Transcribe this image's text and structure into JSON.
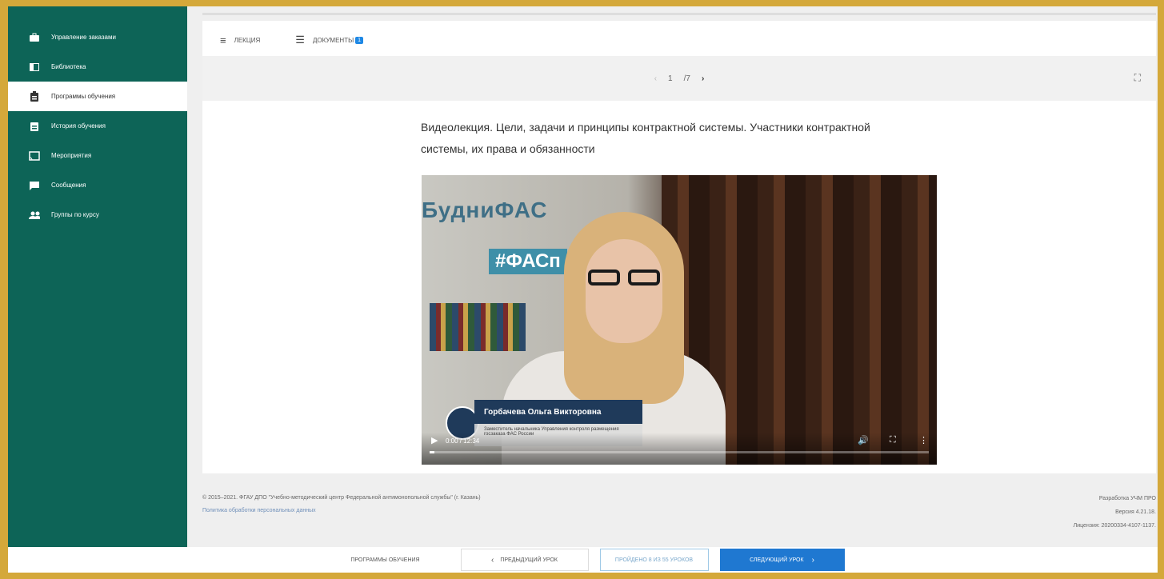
{
  "sidebar": {
    "items": [
      {
        "label": "Управление заказами",
        "icon": "briefcase-icon",
        "active": false
      },
      {
        "label": "Библиотека",
        "icon": "library-icon",
        "active": false
      },
      {
        "label": "Программы обучения",
        "icon": "clipboard-icon",
        "active": true
      },
      {
        "label": "История обучения",
        "icon": "history-icon",
        "active": false
      },
      {
        "label": "Мероприятия",
        "icon": "cast-icon",
        "active": false
      },
      {
        "label": "Сообщения",
        "icon": "message-icon",
        "active": false
      },
      {
        "label": "Группы по курсу",
        "icon": "group-icon",
        "active": false
      }
    ]
  },
  "tabs": {
    "lecture": "ЛЕКЦИЯ",
    "documents": "ДОКУМЕНТЫ",
    "documents_badge": "1"
  },
  "pager": {
    "current": "1",
    "total": "/7"
  },
  "lecture": {
    "title": "Видеолекция. Цели, задачи и принципы контрактной системы. Участники контрактной системы, их права и обязанности"
  },
  "video": {
    "wall_text": "БудниФАС",
    "wall_tag": "#ФАСп",
    "speaker_name": "Горбачева Ольга Викторовна",
    "speaker_role": "Заместитель начальника Управления контроля размещения госзаказа ФАС России",
    "time": "0:00 / 12:34",
    "progress": 0.01
  },
  "footer": {
    "copyright": "© 2015–2021. ФГАУ ДПО \"Учебно-методический центр Федеральной антимонопольной службы\" (г. Казань)",
    "privacy_link": "Политика обработки персональных данных",
    "developer": "Разработка УЧМ ПРО",
    "version": "Версия 4.21.18.",
    "license": "Лицензия: 20200334-4107-1137."
  },
  "bottom_bar": {
    "programs": "ПРОГРАММЫ ОБУЧЕНИЯ",
    "prev": "ПРЕДЫДУЩИЙ УРОК",
    "progress_text": "ПРОЙДЕНО 8 ИЗ 55 УРОКОВ",
    "next": "СЛЕДУЮЩИЙ УРОК"
  },
  "colors": {
    "sidebar_bg": "#0d6457",
    "frame": "#d4a83a",
    "accent": "#1f78d1"
  }
}
